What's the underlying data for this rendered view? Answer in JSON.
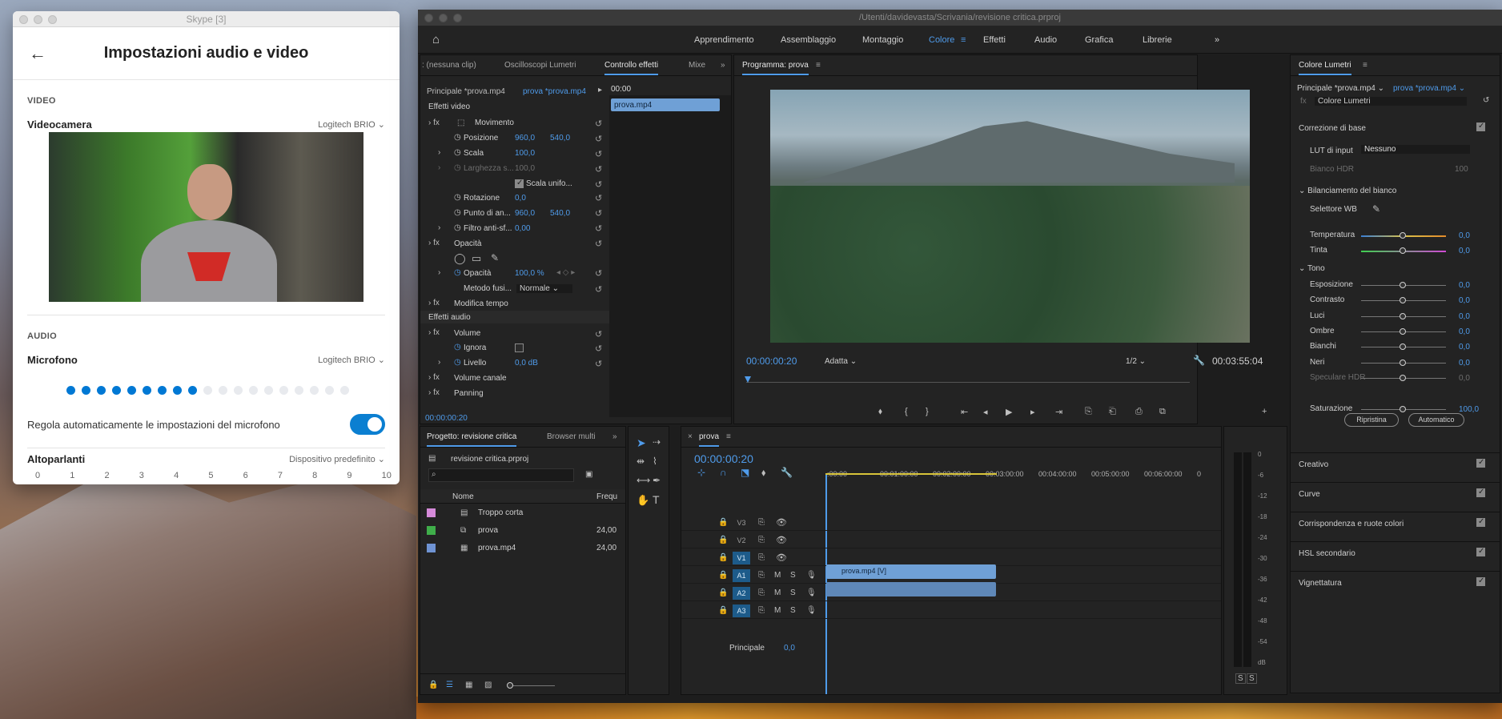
{
  "skype": {
    "window_title": "Skype [3]",
    "title": "Impostazioni audio e video",
    "video_section": "VIDEO",
    "camera_label": "Videocamera",
    "camera_device": "Logitech BRIO",
    "audio_section": "AUDIO",
    "mic_label": "Microfono",
    "mic_device": "Logitech BRIO",
    "mic_level_active": 9,
    "mic_level_total": 19,
    "mic_auto_label": "Regola automaticamente le impostazioni del microfono",
    "mic_auto_on": true,
    "speakers_label": "Altoparlanti",
    "speakers_device": "Dispositivo predefinito",
    "speaker_scale": [
      "0",
      "1",
      "2",
      "3",
      "4",
      "5",
      "6",
      "7",
      "8",
      "9",
      "10"
    ]
  },
  "premiere": {
    "window_title": "/Utenti/davidevasta/Scrivania/revisione critica.prproj",
    "workspaces": [
      "Apprendimento",
      "Assemblaggio",
      "Montaggio",
      "Colore",
      "Effetti",
      "Audio",
      "Grafica",
      "Librerie"
    ],
    "active_workspace": "Colore",
    "more": "»",
    "source_tabs": [
      ": (nessuna clip)",
      "Oscilloscopi Lumetri",
      "Controllo effetti",
      "Mixe"
    ],
    "effect_controls": {
      "master": "Principale *prova.mp4",
      "sequence": "prova *prova.mp4",
      "timecode_start": "00:00",
      "clip_name": "prova.mp4",
      "video_effects": "Effetti video",
      "motion": "Movimento",
      "position": "Posizione",
      "position_x": "960,0",
      "position_y": "540,0",
      "scale": "Scala",
      "scale_value": "100,0",
      "width": "Larghezza s...",
      "width_value": "100,0",
      "uniform_scale": "Scala unifo...",
      "rotation": "Rotazione",
      "rotation_value": "0,0",
      "anchor": "Punto di an...",
      "anchor_x": "960,0",
      "anchor_y": "540,0",
      "antiflicker": "Filtro anti-sf...",
      "antiflicker_value": "0,00",
      "opacity_group": "Opacità",
      "opacity": "Opacità",
      "opacity_value": "100,0 %",
      "blend_mode": "Metodo fusi...",
      "blend_value": "Normale",
      "time_remap": "Modifica tempo",
      "audio_effects": "Effetti audio",
      "volume": "Volume",
      "bypass": "Ignora",
      "level": "Livello",
      "level_value": "0,0 dB",
      "channel_volume": "Volume canale",
      "panning": "Panning",
      "timecode": "00:00:00:20"
    },
    "program": {
      "tab": "Programma: prova",
      "timecode": "00:00:00:20",
      "fit": "Adatta",
      "resolution": "1/2",
      "duration": "00:03:55:04"
    },
    "lumetri": {
      "tab": "Colore Lumetri",
      "master": "Principale *prova.mp4",
      "sequence": "prova *prova.mp4",
      "effect": "Colore Lumetri",
      "basic": "Correzione di base",
      "lut_label": "LUT di input",
      "lut_value": "Nessuno",
      "hdr_white": "Bianco HDR",
      "hdr_white_value": "100",
      "white_balance": "Bilanciamento del bianco",
      "wb_selector": "Selettore WB",
      "temperature": "Temperatura",
      "temperature_value": "0,0",
      "tint": "Tinta",
      "tint_value": "0,0",
      "tone": "Tono",
      "exposure": "Esposizione",
      "exposure_value": "0,0",
      "contrast": "Contrasto",
      "contrast_value": "0,0",
      "highlights": "Luci",
      "highlights_value": "0,0",
      "shadows": "Ombre",
      "shadows_value": "0,0",
      "whites": "Bianchi",
      "whites_value": "0,0",
      "blacks": "Neri",
      "blacks_value": "0,0",
      "hdr_specular": "Speculare HDR",
      "hdr_specular_value": "0,0",
      "reset": "Ripristina",
      "auto": "Automatico",
      "saturation": "Saturazione",
      "saturation_value": "100,0",
      "sections": [
        "Creativo",
        "Curve",
        "Corrispondenza e ruote colori",
        "HSL secondario",
        "Vignettatura"
      ]
    },
    "project": {
      "tab": "Progetto: revisione critica",
      "tab2": "Browser multi",
      "file": "revisione critica.prproj",
      "col_name": "Nome",
      "col_fps": "Frequ",
      "items": [
        {
          "name": "Troppo corta",
          "fps": "",
          "color": "#d58ad9"
        },
        {
          "name": "prova",
          "fps": "24,00",
          "color": "#3fae4a"
        },
        {
          "name": "prova.mp4",
          "fps": "24,00",
          "color": "#6f93d3"
        }
      ]
    },
    "timeline": {
      "tab": "prova",
      "timecode": "00:00:00:20",
      "ruler": [
        ":00:00",
        "00:01:00:00",
        "00:02:00:00",
        "00:03:00:00",
        "00:04:00:00",
        "00:05:00:00",
        "00:06:00:00",
        "0"
      ],
      "video_tracks": [
        "V3",
        "V2",
        "V1"
      ],
      "audio_tracks": [
        "A1",
        "A2",
        "A3"
      ],
      "master": "Principale",
      "master_value": "0,0",
      "clip_video": "prova.mp4 [V]"
    },
    "meter_scale": [
      "0",
      "-6",
      "-12",
      "-18",
      "-24",
      "-30",
      "-36",
      "-42",
      "-48",
      "-54",
      "dB"
    ],
    "meter_solo": [
      "S",
      "S"
    ]
  }
}
